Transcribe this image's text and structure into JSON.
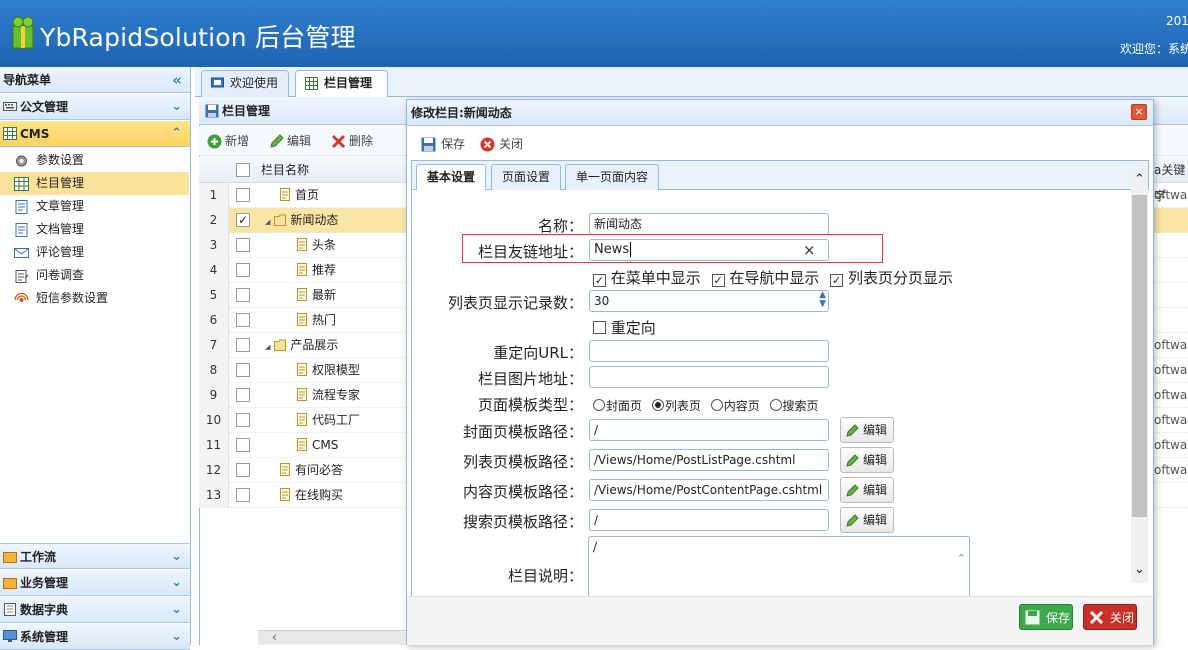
{
  "header": {
    "title": "YbRapidSolution 后台管理",
    "year_fragment": "201",
    "welcome_fragment": "欢迎您：系统"
  },
  "sidebar": {
    "title": "导航菜单",
    "collapse_icon": "«",
    "groups_top": [
      {
        "label": "公文管理",
        "icon": "keyboard-icon"
      },
      {
        "label": "CMS",
        "icon": "grid-icon"
      }
    ],
    "items": [
      {
        "label": "参数设置",
        "icon": "gear-icon"
      },
      {
        "label": "栏目管理",
        "icon": "table-icon"
      },
      {
        "label": "文章管理",
        "icon": "document-icon"
      },
      {
        "label": "文档管理",
        "icon": "document-icon"
      },
      {
        "label": "评论管理",
        "icon": "mail-icon"
      },
      {
        "label": "问卷调查",
        "icon": "clipboard-icon"
      },
      {
        "label": "短信参数设置",
        "icon": "signal-icon"
      }
    ],
    "groups_bottom": [
      {
        "label": "工作流",
        "icon": "folder-icon"
      },
      {
        "label": "业务管理",
        "icon": "folder-icon"
      },
      {
        "label": "数据字典",
        "icon": "book-icon"
      },
      {
        "label": "系统管理",
        "icon": "monitor-icon"
      }
    ]
  },
  "tabs": [
    {
      "label": "欢迎使用"
    },
    {
      "label": "栏目管理",
      "close": "×"
    }
  ],
  "panel": {
    "title": "栏目管理",
    "toolbar": {
      "add": "新增",
      "edit": "编辑",
      "delete": "删除"
    },
    "column_name": "栏目名称",
    "right_header_fragment": "a关键字",
    "rows": [
      {
        "num": "1",
        "name": "首页",
        "indent": 1,
        "right": "oftwa"
      },
      {
        "num": "2",
        "name": "新闻动态",
        "indent": 0,
        "folder": true,
        "right": ""
      },
      {
        "num": "3",
        "name": "头条",
        "indent": 2,
        "right": ""
      },
      {
        "num": "4",
        "name": "推荐",
        "indent": 2,
        "right": ""
      },
      {
        "num": "5",
        "name": "最新",
        "indent": 2,
        "right": ""
      },
      {
        "num": "6",
        "name": "热门",
        "indent": 2,
        "right": ""
      },
      {
        "num": "7",
        "name": "产品展示",
        "indent": 0,
        "folder": true,
        "right": "oftwar"
      },
      {
        "num": "8",
        "name": "权限模型",
        "indent": 2,
        "right": "oftwar"
      },
      {
        "num": "9",
        "name": "流程专家",
        "indent": 2,
        "right": "oftwar"
      },
      {
        "num": "10",
        "name": "代码工厂",
        "indent": 2,
        "right": "oftwar"
      },
      {
        "num": "11",
        "name": "CMS",
        "indent": 2,
        "right": "oftwar"
      },
      {
        "num": "12",
        "name": "有问必答",
        "indent": 1,
        "right": "oftwar"
      },
      {
        "num": "13",
        "name": "在线购买",
        "indent": 1,
        "right": ""
      }
    ]
  },
  "dialog": {
    "title": "修改栏目:新闻动态",
    "close_icon": "×",
    "toolbar": {
      "save": "保存",
      "close": "关闭"
    },
    "tabs": [
      "基本设置",
      "页面设置",
      "单一页面内容"
    ],
    "form": {
      "name_label": "名称：",
      "name_value": "新闻动态",
      "friendly_url_label": "栏目友链地址：",
      "friendly_url_value": "News",
      "clear_icon": "×",
      "show_in_menu": "在菜单中显示",
      "show_in_nav": "在导航中显示",
      "list_paging": "列表页分页显示",
      "page_size_label": "列表页显示记录数：",
      "page_size_value": "30",
      "redirect_check": "重定向",
      "redirect_url_label": "重定向URL：",
      "redirect_url_value": "",
      "image_url_label": "栏目图片地址：",
      "image_url_value": "",
      "template_type_label": "页面模板类型：",
      "template_types": [
        "封面页",
        "列表页",
        "内容页",
        "搜索页"
      ],
      "cover_tpl_label": "封面页模板路径：",
      "cover_tpl_value": "/",
      "list_tpl_label": "列表页模板路径：",
      "list_tpl_value": "/Views/Home/PostListPage.cshtml",
      "content_tpl_label": "内容页模板路径：",
      "content_tpl_value": "/Views/Home/PostContentPage.cshtml",
      "search_tpl_label": "搜索页模板路径：",
      "search_tpl_value": "/",
      "desc_label": "栏目说明：",
      "desc_value": "/",
      "edit_label": "编辑"
    },
    "footer": {
      "save": "保存",
      "close": "关闭"
    }
  },
  "colors": {
    "header": "#2372c2",
    "selected_row": "#fbe5a4",
    "highlight_box": "#e03a3a"
  }
}
